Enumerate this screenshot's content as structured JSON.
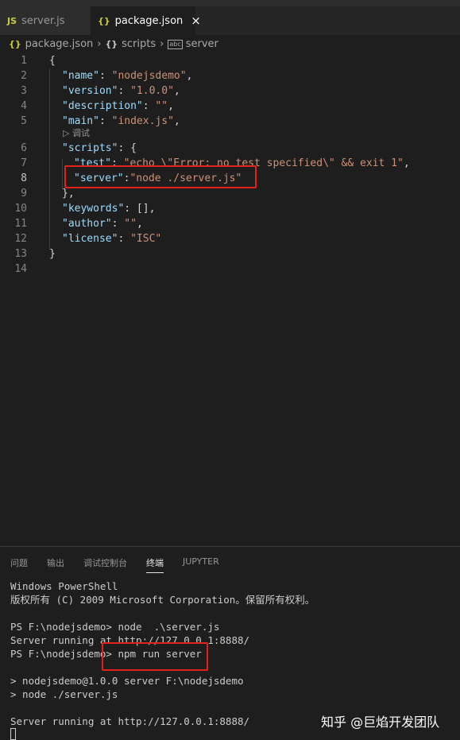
{
  "tabs": [
    {
      "icon": "JS",
      "label": "server.js",
      "active": false
    },
    {
      "icon": "{}",
      "label": "package.json",
      "active": true,
      "close": "×"
    }
  ],
  "breadcrumb": {
    "file_icon": "{}",
    "file": "package.json",
    "section_icon": "{}",
    "section": "scripts",
    "item_icon": "abc",
    "item": "server"
  },
  "editor": {
    "codelens": "▷ 调试",
    "current_line": 8,
    "lines": [
      {
        "n": "1"
      },
      {
        "n": "2"
      },
      {
        "n": "3"
      },
      {
        "n": "4"
      },
      {
        "n": "5"
      },
      {
        "n": "6"
      },
      {
        "n": "7"
      },
      {
        "n": "8"
      },
      {
        "n": "9"
      },
      {
        "n": "10"
      },
      {
        "n": "11"
      },
      {
        "n": "12"
      },
      {
        "n": "13"
      },
      {
        "n": "14"
      }
    ],
    "code": {
      "l1": "{",
      "l2k": "\"name\"",
      "l2s": "\"nodejsdemo\"",
      "l3k": "\"version\"",
      "l3s": "\"1.0.0\"",
      "l4k": "\"description\"",
      "l4s": "\"\"",
      "l5k": "\"main\"",
      "l5s": "\"index.js\"",
      "l6k": "\"scripts\"",
      "l6p": ": {",
      "l7k": "\"test\"",
      "l7s": "\"echo \\\"Error: no test specified\\\" && exit 1\"",
      "l8k": "\"server\"",
      "l8s": "\"node ./server.js\"",
      "l9": "},",
      "l10k": "\"keywords\"",
      "l10p": ": [],",
      "l11k": "\"author\"",
      "l11s": "\"\"",
      "l12k": "\"license\"",
      "l12s": "\"ISC\"",
      "l13": "}"
    }
  },
  "panel": {
    "tabs": [
      "问题",
      "输出",
      "调试控制台",
      "终端",
      "JUPYTER"
    ],
    "active_tab": "终端"
  },
  "terminal": {
    "lines": [
      "Windows PowerShell",
      "版权所有 (C) 2009 Microsoft Corporation。保留所有权利。",
      "",
      "PS F:\\nodejsdemo> node  .\\server.js",
      "Server running at http://127.0.0.1:8888/",
      "PS F:\\nodejsdemo> npm run server",
      "",
      "> nodejsdemo@1.0.0 server F:\\nodejsdemo",
      "> node ./server.js",
      "",
      "Server running at http://127.0.0.1:8888/"
    ]
  },
  "watermark": "知乎 @巨焰开发团队",
  "colors": {
    "highlight_box": "#e2231a",
    "json_key": "#9cdcfe",
    "json_string": "#ce9178"
  }
}
